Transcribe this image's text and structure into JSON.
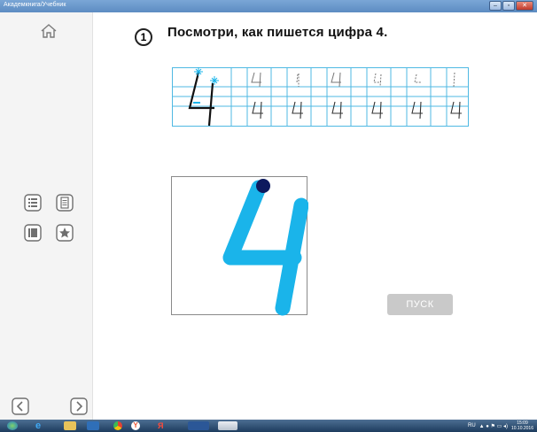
{
  "window": {
    "title": "Академкнига/Учебник",
    "minimize_label": "–",
    "restore_label": "▫",
    "close_label": "✕"
  },
  "sidebar": {
    "icons": [
      "home-icon",
      "list-icon",
      "document-icon",
      "book-icon",
      "star-icon",
      "arrow-left-icon",
      "arrow-right-icon"
    ]
  },
  "exercise": {
    "number": "1",
    "instruction": "Посмотри, как пишется цифра 4.",
    "digit": "4",
    "play_label": "ПУСК"
  },
  "colors": {
    "digit": "#1ab4ea",
    "grid_line": "#4fb9e3",
    "start_dot": "#0d1a5e",
    "button": "#c9c9c9"
  },
  "taskbar": {
    "lang": "RU",
    "time": "15:09",
    "date": "10.10.2016",
    "apps": [
      "start-orb-icon",
      "internet-explorer-icon",
      "file-explorer-icon",
      "media-player-icon",
      "chrome-icon",
      "yandex-browser-icon",
      "yandex-icon",
      "word-icon",
      "app-icon"
    ]
  }
}
